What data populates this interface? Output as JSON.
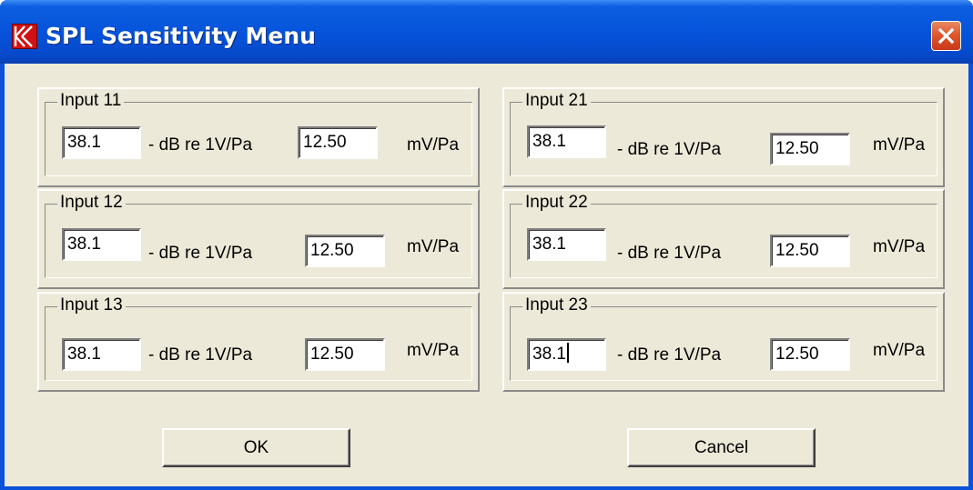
{
  "window": {
    "title": "SPL Sensitivity Menu",
    "close_icon": "close-x-icon",
    "app_icon": "k-logo-icon",
    "accent_color": "#0552da",
    "close_color": "#e0582e"
  },
  "inputs_left": [
    {
      "label": "Input 11",
      "db_value": "38.1",
      "db_unit": "- dB re 1V/Pa",
      "mv_value": "12.50",
      "mv_unit": "mV/Pa"
    },
    {
      "label": "Input 12",
      "db_value": "38.1",
      "db_unit": "- dB re 1V/Pa",
      "mv_value": "12.50",
      "mv_unit": "mV/Pa"
    },
    {
      "label": "Input 13",
      "db_value": "38.1",
      "db_unit": "- dB re 1V/Pa",
      "mv_value": "12.50",
      "mv_unit": "mV/Pa"
    }
  ],
  "inputs_right": [
    {
      "label": "Input 21",
      "db_value": "38.1",
      "db_unit": "- dB re 1V/Pa",
      "mv_value": "12.50",
      "mv_unit": "mV/Pa"
    },
    {
      "label": "Input 22",
      "db_value": "38.1",
      "db_unit": "- dB re 1V/Pa",
      "mv_value": "12.50",
      "mv_unit": "mV/Pa"
    },
    {
      "label": "Input 23",
      "db_value": "38.1",
      "db_unit": "- dB re 1V/Pa",
      "mv_value": "12.50",
      "mv_unit": "mV/Pa"
    }
  ],
  "buttons": {
    "ok_label": "OK",
    "cancel_label": "Cancel"
  }
}
